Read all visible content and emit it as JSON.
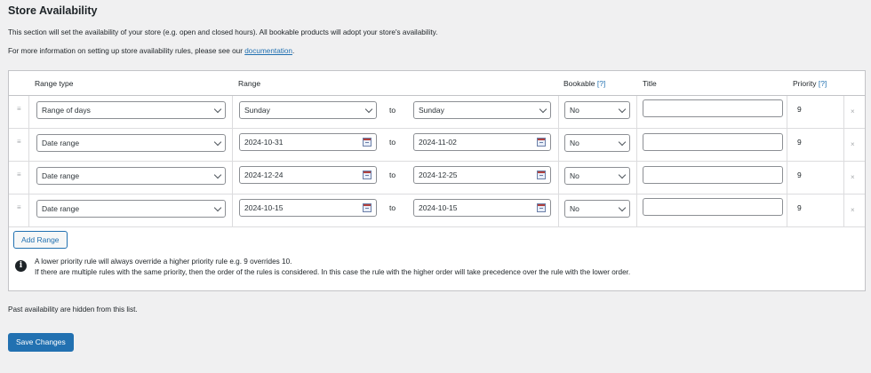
{
  "section": {
    "title": "Store Availability",
    "desc1": "This section will set the availability of your store (e.g. open and closed hours). All bookable products will adopt your store's availability.",
    "desc2_prefix": "For more information on setting up store availability rules, please see our ",
    "desc2_link": "documentation",
    "desc2_suffix": "."
  },
  "table": {
    "headers": {
      "range_type": "Range type",
      "range": "Range",
      "bookable": "Bookable",
      "bookable_help": "[?]",
      "title": "Title",
      "priority": "Priority",
      "priority_help": "[?]"
    },
    "to_label": "to",
    "drag_icon": "drag-handle-icon",
    "delete_icon": "delete-x-icon",
    "delete_glyph": "×",
    "rows": [
      {
        "range_type": "Range of days",
        "from": "Sunday",
        "to": "Sunday",
        "bookable": "No",
        "title": "",
        "priority": "9"
      },
      {
        "range_type": "Date range",
        "from": "2024-10-31",
        "to": "2024-11-02",
        "bookable": "No",
        "title": "",
        "priority": "9"
      },
      {
        "range_type": "Date range",
        "from": "2024-12-24",
        "to": "2024-12-25",
        "bookable": "No",
        "title": "",
        "priority": "9"
      },
      {
        "range_type": "Date range",
        "from": "2024-10-15",
        "to": "2024-10-15",
        "bookable": "No",
        "title": "",
        "priority": "9"
      }
    ]
  },
  "add_range_label": "Add Range",
  "info": {
    "icon": "info-icon",
    "glyph": "i",
    "line1": "A lower priority rule will always override a higher priority rule e.g. 9 overrides 10.",
    "line2": "If there are multiple rules with the same priority, then the order of the rules is considered. In this case the rule with the higher order will take precedence over the rule with the lower order."
  },
  "footer_note": "Past availability are hidden from this list.",
  "save_label": "Save Changes",
  "colors": {
    "accent": "#2271b1",
    "background": "#f0f0f1"
  }
}
